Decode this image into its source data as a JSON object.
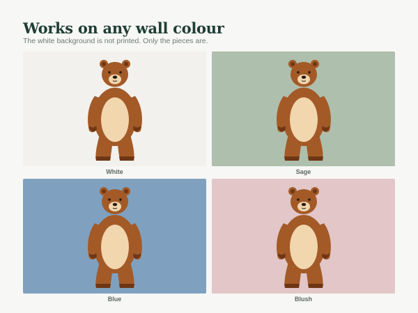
{
  "header": {
    "title": "Works on any wall colour",
    "subtitle": "The white background is not printed. Only the pieces are."
  },
  "swatches": [
    {
      "label": "White",
      "color": "#f2f1ee"
    },
    {
      "label": "Sage",
      "color": "#afbfad"
    },
    {
      "label": "Blue",
      "color": "#7fa1bf"
    },
    {
      "label": "Blush",
      "color": "#e2c6c8"
    }
  ],
  "artwork": {
    "icon": "brown-bear-illustration",
    "colors": {
      "fur": "#a35a27",
      "fur_dark": "#6e3614",
      "belly": "#f1d6ae",
      "nose": "#2a1a10"
    }
  }
}
